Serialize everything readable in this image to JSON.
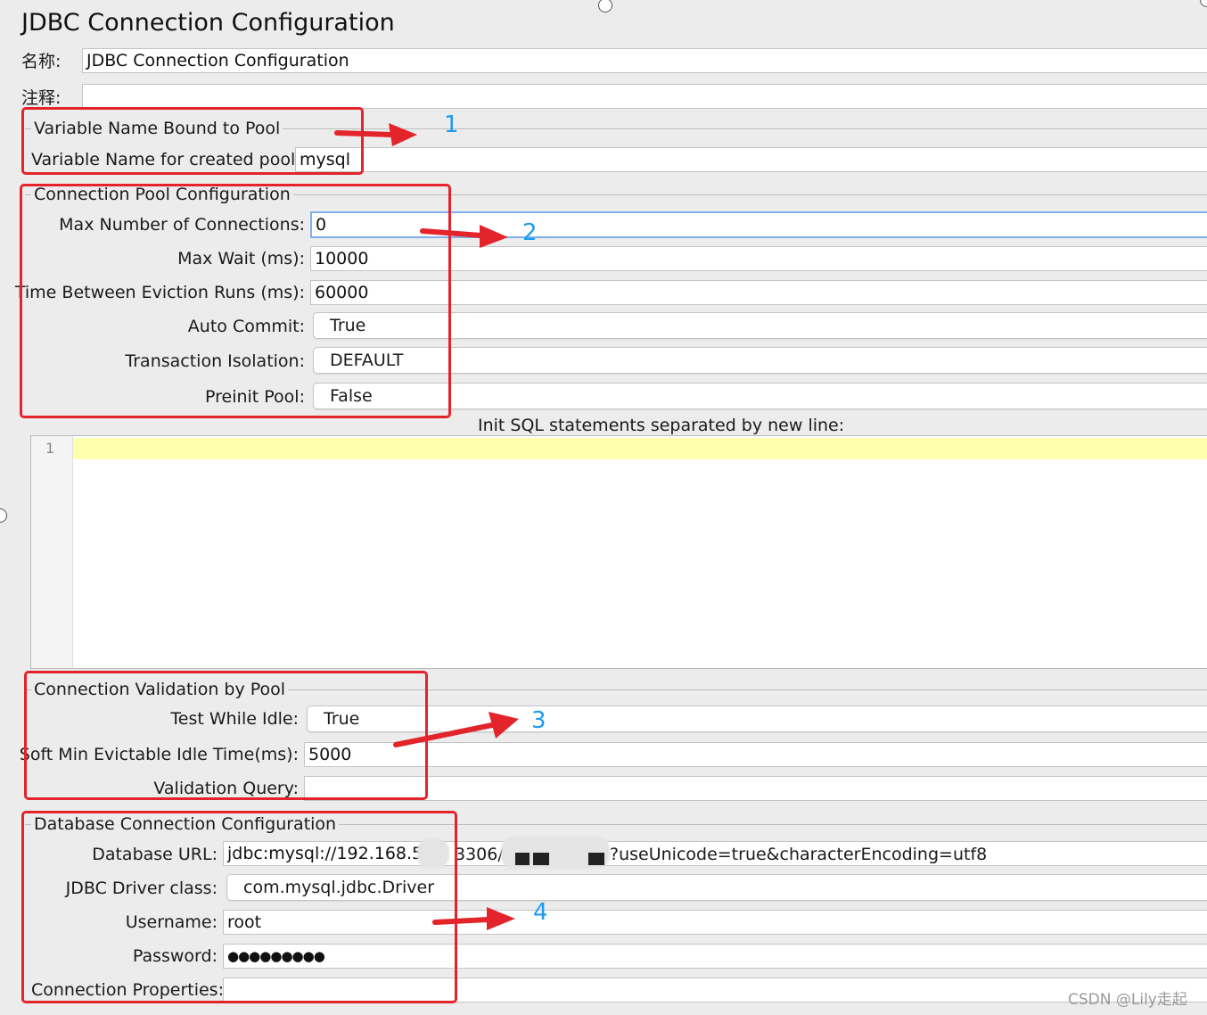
{
  "title": "JDBC Connection Configuration",
  "name_label": "名称:",
  "name_value": "JDBC Connection Configuration",
  "comment_label": "注释:",
  "comment_value": "",
  "pool_var": {
    "section": "Variable Name Bound to Pool",
    "label": "Variable Name for created pool:",
    "value": "mysql"
  },
  "pool_config": {
    "section": "Connection Pool Configuration",
    "max_connections_label": "Max Number of Connections:",
    "max_connections_value": "0",
    "max_wait_label": "Max Wait (ms):",
    "max_wait_value": "10000",
    "eviction_label": "Time Between Eviction Runs (ms):",
    "eviction_value": "60000",
    "auto_commit_label": "Auto Commit:",
    "auto_commit_value": "True",
    "isolation_label": "Transaction Isolation:",
    "isolation_value": "DEFAULT",
    "preinit_label": "Preinit Pool:",
    "preinit_value": "False"
  },
  "init_sql": {
    "label": "Init SQL statements separated by new line:",
    "line_number": "1"
  },
  "validation": {
    "section": "Connection Validation by Pool",
    "test_idle_label": "Test While Idle:",
    "test_idle_value": "True",
    "soft_min_label": "Soft Min Evictable Idle Time(ms):",
    "soft_min_value": "5000",
    "query_label": "Validation Query:",
    "query_value": ""
  },
  "db_config": {
    "section": "Database Connection Configuration",
    "url_label": "Database URL:",
    "url_part1": "jdbc:mysql://192.168.5",
    "url_part2": "3306/",
    "url_part3": "?useUnicode=true&characterEncoding=utf8",
    "driver_label": "JDBC Driver class:",
    "driver_value": "com.mysql.jdbc.Driver",
    "username_label": "Username:",
    "username_value": "root",
    "password_label": "Password:",
    "password_value": "●●●●●●●●●",
    "props_label": "Connection Properties:",
    "props_value": ""
  },
  "annotations": {
    "n1": "1",
    "n2": "2",
    "n3": "3",
    "n4": "4",
    "color_box": "#e3242b",
    "color_number": "#1e9bf0"
  },
  "watermark": "CSDN @Lily走起"
}
